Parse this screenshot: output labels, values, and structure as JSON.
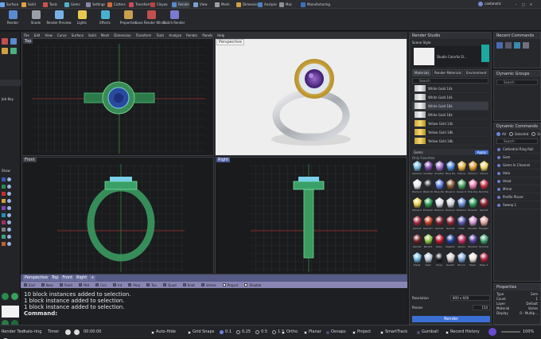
{
  "tabs": [
    {
      "label": "Surface",
      "color": "#6aa3e8"
    },
    {
      "label": "Solid",
      "color": "#e0a040"
    },
    {
      "label": "Tools",
      "color": "#d05050"
    },
    {
      "label": "Gems",
      "color": "#4fb0c8"
    },
    {
      "label": "Settings",
      "color": "#8888aa"
    },
    {
      "label": "Cutters",
      "color": "#d06a3a"
    },
    {
      "label": "Transform",
      "color": "#d04a5a"
    },
    {
      "label": "Clayoo",
      "color": "#c04040"
    },
    {
      "label": "Render",
      "color": "#5a8ad0"
    },
    {
      "label": "View",
      "color": "#7aa0d0"
    },
    {
      "label": "Mesh",
      "color": "#a0a0a0"
    },
    {
      "label": "Dimension",
      "color": "#d0a040"
    },
    {
      "label": "Analyze",
      "color": "#5080c0"
    },
    {
      "label": "Mac",
      "color": "#909090"
    },
    {
      "label": "Manufacturing",
      "color": "#3a70c0"
    }
  ],
  "account_name": "caetanotic",
  "ribbon": [
    {
      "label": "Render",
      "color": "#5a8ad0"
    },
    {
      "label": "Shade",
      "color": "#9aa0a8"
    },
    {
      "label": "Render Preview",
      "color": "#7ab0e8"
    },
    {
      "label": "Lights",
      "color": "#e8c850"
    },
    {
      "label": "Effects",
      "color": "#4ab0d0"
    },
    {
      "label": "Properties",
      "color": "#c8a050"
    },
    {
      "label": "Save Render Wind...",
      "color": "#c05050"
    },
    {
      "label": "Batch Render",
      "color": "#7a7ad0"
    }
  ],
  "menubar": [
    "File",
    "Edit",
    "View",
    "Curve",
    "Surface",
    "Solid",
    "Mesh",
    "Dimension",
    "Transform",
    "Tools",
    "Analyze",
    "Render",
    "Panels",
    "Help"
  ],
  "viewports": {
    "top": "Top",
    "perspective": "Perspective",
    "front": "Front",
    "right": "Right"
  },
  "viewport_tabs": [
    "Perspective",
    "Top",
    "Front",
    "Right",
    "+"
  ],
  "osnaps": [
    {
      "label": "End",
      "checked": true
    },
    {
      "label": "Near",
      "checked": true
    },
    {
      "label": "Point",
      "checked": true
    },
    {
      "label": "Mid",
      "checked": true
    },
    {
      "label": "Cen",
      "checked": true
    },
    {
      "label": "Int",
      "checked": true
    },
    {
      "label": "Perp",
      "checked": true
    },
    {
      "label": "Tan",
      "checked": true
    },
    {
      "label": "Quad",
      "checked": true
    },
    {
      "label": "Knot",
      "checked": true
    },
    {
      "label": "Vertex",
      "checked": true
    },
    {
      "label": "Project",
      "checked": false
    },
    {
      "label": "Disable",
      "checked": false
    }
  ],
  "command_history": [
    "10 block instances added to selection.",
    "1 block instance added to selection.",
    "1 block instance added to selection."
  ],
  "command_prompt": "Command:",
  "left_panel": {
    "show_label": "Show",
    "bay_label": "Job Bay"
  },
  "render_studio": {
    "title": "Render Studio",
    "scene_style_label": "Scene Style",
    "scene_name": "Studio Colorful D...",
    "tabs": [
      "Materials",
      "Render Materials",
      "Environment"
    ],
    "search_placeholder": "Search",
    "materials": [
      {
        "name": "White Gold 14k",
        "kind": "white"
      },
      {
        "name": "White Gold 14k",
        "kind": "white"
      },
      {
        "name": "White Gold 18k",
        "kind": "white"
      },
      {
        "name": "White Gold 18k",
        "kind": "white"
      },
      {
        "name": "Yellow Gold 14k",
        "kind": "gold"
      },
      {
        "name": "Yellow Gold 18k",
        "kind": "gold"
      },
      {
        "name": "Yellow Gold 18k",
        "kind": "gold"
      }
    ],
    "gems_label": "Gems",
    "apply_label": "Apply",
    "gem_favorites_label": "Only Favorites",
    "gems": [
      {
        "name": "Aquamarine",
        "color": "#6fb7d8"
      },
      {
        "name": "Amethyst",
        "color": "#7a4aa8"
      },
      {
        "name": "Amethyst",
        "color": "#9a6ac8"
      },
      {
        "name": "Blue Topaz",
        "color": "#4a8ad8"
      },
      {
        "name": "Citrine",
        "color": "#e0b040"
      },
      {
        "name": "Citrine Med.",
        "color": "#d89a30"
      },
      {
        "name": "Citrine",
        "color": "#f0d060"
      },
      {
        "name": "Diamond",
        "color": "#e8e8f0"
      },
      {
        "name": "Black Diam.",
        "color": "#303038"
      },
      {
        "name": "Blue Diam.",
        "color": "#5a7ae0"
      },
      {
        "name": "Brown Diam.",
        "color": "#8a5a30"
      },
      {
        "name": "Green Diam.",
        "color": "#4aa060"
      },
      {
        "name": "Pink Diam.",
        "color": "#e07aa8"
      },
      {
        "name": "Red Diam.",
        "color": "#c03040"
      },
      {
        "name": "Yellow Diam.",
        "color": "#e8d050"
      },
      {
        "name": "Emerald",
        "color": "#2a9a50"
      },
      {
        "name": "Diamond 2",
        "color": "#d8dce8"
      },
      {
        "name": "Diamond 3",
        "color": "#c8ccd8"
      },
      {
        "name": "Diamond Blue",
        "color": "#6a8ad0"
      },
      {
        "name": "Emerald",
        "color": "#30a060"
      },
      {
        "name": "Garnet",
        "color": "#8a2030"
      },
      {
        "name": "Garnet",
        "color": "#a02840"
      },
      {
        "name": "Garnet Org.",
        "color": "#c04020"
      },
      {
        "name": "Garnet",
        "color": "#802030"
      },
      {
        "name": "Garnet",
        "color": "#902838"
      },
      {
        "name": "Iolite",
        "color": "#5a5ab0"
      },
      {
        "name": "Kunzite",
        "color": "#c890c8"
      },
      {
        "name": "Morganite",
        "color": "#e0a0a0"
      },
      {
        "name": "Garnet",
        "color": "#702028"
      },
      {
        "name": "Peridot",
        "color": "#90c040"
      },
      {
        "name": "Ruby",
        "color": "#c01830"
      },
      {
        "name": "Sapphire",
        "color": "#2040a0"
      },
      {
        "name": "Spinel",
        "color": "#c03060"
      },
      {
        "name": "Tanzanite",
        "color": "#5040a0"
      },
      {
        "name": "Tourmaline",
        "color": "#40a070"
      },
      {
        "name": "Topaz",
        "color": "#70b8e0"
      },
      {
        "name": "Opal",
        "color": "#b8c8d8"
      },
      {
        "name": "Onyx",
        "color": "#202024"
      },
      {
        "name": "Quartz",
        "color": "#d0c8c8"
      },
      {
        "name": "Zircon",
        "color": "#80a8d8"
      },
      {
        "name": "Pearl",
        "color": "#e8e4dc"
      },
      {
        "name": "Ruby 2",
        "color": "#b02040"
      }
    ],
    "resolution_label": "Resolution",
    "resolution_value": "800 x 600",
    "passes_label": "Passes",
    "passes_value": "150",
    "render_button": "Render"
  },
  "recent_commands": {
    "title": "Recent Commands"
  },
  "dynamic_groups": {
    "title": "Dynamic Groups",
    "search_placeholder": "Search"
  },
  "dynamic_commands": {
    "title": "Dynamic Commands",
    "filters": [
      "All",
      "Selected",
      "Group"
    ],
    "search_placeholder": "Search",
    "items": [
      "Cathedral Ring Rail",
      "Gem",
      "Gems In Channel",
      "Halo",
      "Head",
      "Mirror",
      "Profile Placer",
      "Sweep 1"
    ]
  },
  "properties": {
    "title": "Properties",
    "rows": [
      {
        "key": "Type",
        "value": "Gem"
      },
      {
        "key": "Count",
        "value": "1"
      },
      {
        "key": "Layer",
        "value": "Default"
      },
      {
        "key": "Material",
        "value": "Varies"
      },
      {
        "key": "Display",
        "value": "0 - Multip..."
      }
    ]
  },
  "status": {
    "render_test": "Render Test",
    "file_name": "halo-ring",
    "timer_label": "Timer",
    "timer_value": "00:00:00",
    "auto_hide": "Auto-Hide",
    "grid_snaps": "Grid Snaps",
    "snap_values": [
      "0.1",
      "0.25",
      "0.5",
      "1.0"
    ],
    "ortho": "Ortho",
    "planar": "Planar",
    "osnap": "Osnaps",
    "project": "Project",
    "smarttrack": "SmartTrack",
    "gumball": "Gumball",
    "record_history": "Record History",
    "zoom": "100%"
  }
}
